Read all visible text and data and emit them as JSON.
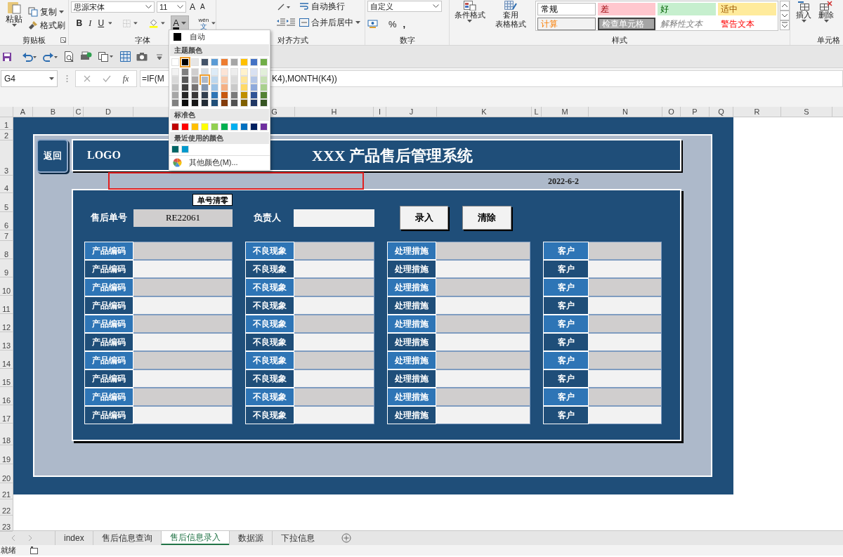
{
  "ribbon": {
    "clipboard": {
      "paste": "粘贴",
      "copy": "复制",
      "format_painter": "格式刷",
      "label": "剪贴板"
    },
    "font": {
      "font_name": "思源宋体",
      "font_size": "11",
      "grow": "A",
      "shrink": "A",
      "bold": "B",
      "italic": "I",
      "underline": "U",
      "font_color": "A",
      "phonetic_top": "wén",
      "phonetic_bottom": "文",
      "label": "字体"
    },
    "alignment": {
      "wrap_text": "自动换行",
      "merge_center": "合并后居中",
      "label": "对齐方式"
    },
    "number": {
      "format": "自定义",
      "percent": "%",
      "comma": ",",
      "label": "数字"
    },
    "styles": {
      "conditional": "条件格式",
      "table_format_1": "套用",
      "table_format_2": "表格格式",
      "label": "样式",
      "gallery": [
        {
          "label": "常规",
          "kind": "normal"
        },
        {
          "label": "差",
          "kind": "bad"
        },
        {
          "label": "好",
          "kind": "good"
        },
        {
          "label": "适中",
          "kind": "neutral"
        },
        {
          "label": "计算",
          "kind": "calculation"
        },
        {
          "label": "检查单元格",
          "kind": "check"
        },
        {
          "label": "解释性文本",
          "kind": "explanatory"
        },
        {
          "label": "警告文本",
          "kind": "warning"
        }
      ]
    },
    "cells": {
      "insert": "插入",
      "delete": "删除",
      "label": "单元格"
    }
  },
  "formula_bar": {
    "name_box": "G4",
    "fx": "fx",
    "formula_start": "=IF(M",
    "formula_end": "K4),MONTH(K4))"
  },
  "columns": [
    "A",
    "B",
    "C",
    "D",
    "G",
    "H",
    "I",
    "J",
    "K",
    "L",
    "M",
    "N",
    "O",
    "P",
    "Q",
    "R",
    "S"
  ],
  "rows": [
    "1",
    "2",
    "3",
    "4",
    "5",
    "6",
    "7",
    "8",
    "9",
    "10",
    "11",
    "12",
    "13",
    "14",
    "15",
    "16",
    "17",
    "18",
    "19",
    "20",
    "21",
    "22",
    "23"
  ],
  "form": {
    "back_button": "返回",
    "logo": "LOGO",
    "title": "XXX 产品售后管理系统",
    "date": "2022-6-2",
    "clear_number_button": "单号清零",
    "order_label": "售后单号",
    "order_value": "RE22061",
    "owner_label": "负责人",
    "submit_button": "录入",
    "clear_button": "清除",
    "grid": [
      [
        "产品编码",
        "不良现象",
        "处理措施",
        "客户"
      ],
      [
        "产品编码",
        "不良现象",
        "处理措施",
        "客户"
      ],
      [
        "产品编码",
        "不良现象",
        "处理措施",
        "客户"
      ],
      [
        "产品编码",
        "不良现象",
        "处理措施",
        "客户"
      ],
      [
        "产品编码",
        "不良现象",
        "处理措施",
        "客户"
      ],
      [
        "产品编码",
        "不良现象",
        "处理措施",
        "客户"
      ],
      [
        "产品编码",
        "不良现象",
        "处理措施",
        "客户"
      ],
      [
        "产品编码",
        "不良现象",
        "处理措施",
        "客户"
      ],
      [
        "产品编码",
        "不良现象",
        "处理措施",
        "客户"
      ],
      [
        "产品编码",
        "不良现象",
        "处理措施",
        "客户"
      ]
    ]
  },
  "color_menu": {
    "automatic": "自动",
    "theme_heading": "主题颜色",
    "theme": [
      {
        "color": "#ffffff",
        "selected": false
      },
      {
        "color": "#000000",
        "selected": true
      },
      {
        "color": "#e7e6e6",
        "selected": false
      },
      {
        "color": "#44546a",
        "selected": false
      },
      {
        "color": "#5b9bd5",
        "selected": false
      },
      {
        "color": "#ed7d31",
        "selected": false
      },
      {
        "color": "#a5a5a5",
        "selected": false
      },
      {
        "color": "#ffc000",
        "selected": false
      },
      {
        "color": "#4472c4",
        "selected": false
      },
      {
        "color": "#70ad47",
        "selected": false
      }
    ],
    "shades": [
      [
        {
          "color": "#f2f2f2",
          "selected": false
        },
        {
          "color": "#7f7f7f",
          "selected": false
        },
        {
          "color": "#d0cece",
          "selected": false
        },
        {
          "color": "#d6dce4",
          "selected": false
        },
        {
          "color": "#ddebf7",
          "selected": false
        },
        {
          "color": "#fce4d6",
          "selected": false
        },
        {
          "color": "#ededed",
          "selected": false
        },
        {
          "color": "#fff2cc",
          "selected": false
        },
        {
          "color": "#d9e1f2",
          "selected": false
        },
        {
          "color": "#e2efda",
          "selected": false
        }
      ],
      [
        {
          "color": "#d9d9d9",
          "selected": false
        },
        {
          "color": "#595959",
          "selected": false
        },
        {
          "color": "#aeaaaa",
          "selected": false
        },
        {
          "color": "#adb9ca",
          "selected": true
        },
        {
          "color": "#bdd7ee",
          "selected": false
        },
        {
          "color": "#f8cbad",
          "selected": false
        },
        {
          "color": "#dbdbdb",
          "selected": false
        },
        {
          "color": "#ffe699",
          "selected": false
        },
        {
          "color": "#b4c6e7",
          "selected": false
        },
        {
          "color": "#c6e0b4",
          "selected": false
        }
      ],
      [
        {
          "color": "#bfbfbf",
          "selected": false
        },
        {
          "color": "#404040",
          "selected": false
        },
        {
          "color": "#757171",
          "selected": false
        },
        {
          "color": "#8497b0",
          "selected": false
        },
        {
          "color": "#9bc2e6",
          "selected": false
        },
        {
          "color": "#f4b084",
          "selected": false
        },
        {
          "color": "#c9c9c9",
          "selected": false
        },
        {
          "color": "#ffd966",
          "selected": false
        },
        {
          "color": "#8ea9db",
          "selected": false
        },
        {
          "color": "#a9d08e",
          "selected": false
        }
      ],
      [
        {
          "color": "#a6a6a6",
          "selected": false
        },
        {
          "color": "#262626",
          "selected": false
        },
        {
          "color": "#3a3838",
          "selected": false
        },
        {
          "color": "#333f4f",
          "selected": false
        },
        {
          "color": "#2f75b5",
          "selected": false
        },
        {
          "color": "#c65911",
          "selected": false
        },
        {
          "color": "#7b7b7b",
          "selected": false
        },
        {
          "color": "#bf8f00",
          "selected": false
        },
        {
          "color": "#305496",
          "selected": false
        },
        {
          "color": "#548235",
          "selected": false
        }
      ],
      [
        {
          "color": "#808080",
          "selected": false
        },
        {
          "color": "#0d0d0d",
          "selected": false
        },
        {
          "color": "#171616",
          "selected": false
        },
        {
          "color": "#222b35",
          "selected": false
        },
        {
          "color": "#1f4e78",
          "selected": false
        },
        {
          "color": "#833c0c",
          "selected": false
        },
        {
          "color": "#525252",
          "selected": false
        },
        {
          "color": "#806000",
          "selected": false
        },
        {
          "color": "#203764",
          "selected": false
        },
        {
          "color": "#375623",
          "selected": false
        }
      ]
    ],
    "standard_heading": "标准色",
    "standard": [
      {
        "color": "#c00000",
        "selected": false
      },
      {
        "color": "#ff0000",
        "selected": false
      },
      {
        "color": "#ffc000",
        "selected": false
      },
      {
        "color": "#ffff00",
        "selected": false
      },
      {
        "color": "#92d050",
        "selected": false
      },
      {
        "color": "#00b050",
        "selected": false
      },
      {
        "color": "#00b0f0",
        "selected": false
      },
      {
        "color": "#0070c0",
        "selected": false
      },
      {
        "color": "#002060",
        "selected": false
      },
      {
        "color": "#7030a0",
        "selected": false
      }
    ],
    "recent_heading": "最近使用的颜色",
    "recent": [
      {
        "color": "#006666",
        "selected": false
      },
      {
        "color": "#0099cc",
        "selected": false
      }
    ],
    "more_colors": "其他颜色(M)..."
  },
  "sheet_tabs": [
    {
      "label": "index",
      "selected": false
    },
    {
      "label": "售后信息查询",
      "selected": false
    },
    {
      "label": "售后信息录入",
      "selected": true
    },
    {
      "label": "数据源",
      "selected": false
    },
    {
      "label": "下拉信息",
      "selected": false
    }
  ],
  "status_bar": {
    "status": "就绪"
  }
}
